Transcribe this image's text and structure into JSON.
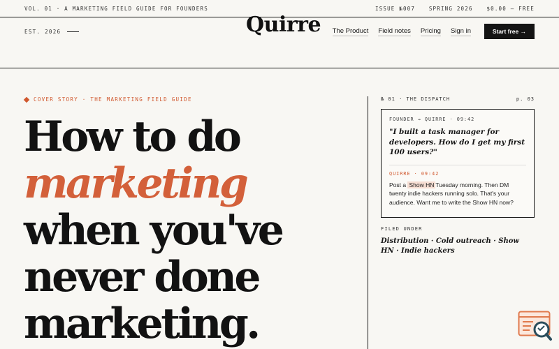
{
  "topbar": {
    "left": "VOL. 01 · A MARKETING FIELD GUIDE FOR FOUNDERS",
    "issue": "ISSUE №007",
    "season": "SPRING 2026",
    "price": "$0.00 — FREE"
  },
  "header": {
    "est": "EST. 2026",
    "logo": "Quirre",
    "nav": [
      "The Product",
      "Field notes",
      "Pricing",
      "Sign in"
    ],
    "cta": "Start free →"
  },
  "hero": {
    "kicker": "COVER STORY · THE MARKETING FIELD GUIDE",
    "lines": [
      "How to do",
      "marketing",
      "when you've",
      "never done",
      "marketing."
    ]
  },
  "dispatch": {
    "section": "№ 01 · THE DISPATCH",
    "page": "p. 03",
    "founder_meta": "FOUNDER → QUIRRE · 09:42",
    "question": "\"I built a task manager for developers. How do I get my first 100 users?\"",
    "quirre_meta": "QUIRRE · 09:42",
    "reply_before": "Post a ",
    "reply_highlight": "Show HN",
    "reply_after": "Tuesday morning. Then DM twenty indie hackers running solo. That's your audience. Want me to write the Show HN now?"
  },
  "filed": {
    "label": "FILED UNDER",
    "tags": "Distribution · Cold outreach · Show HN · Indie hackers"
  },
  "colors": {
    "accent": "#d0582e",
    "ink": "#141414",
    "paper": "#f8f7f3"
  },
  "icons": {
    "widget": "search-window-icon"
  }
}
